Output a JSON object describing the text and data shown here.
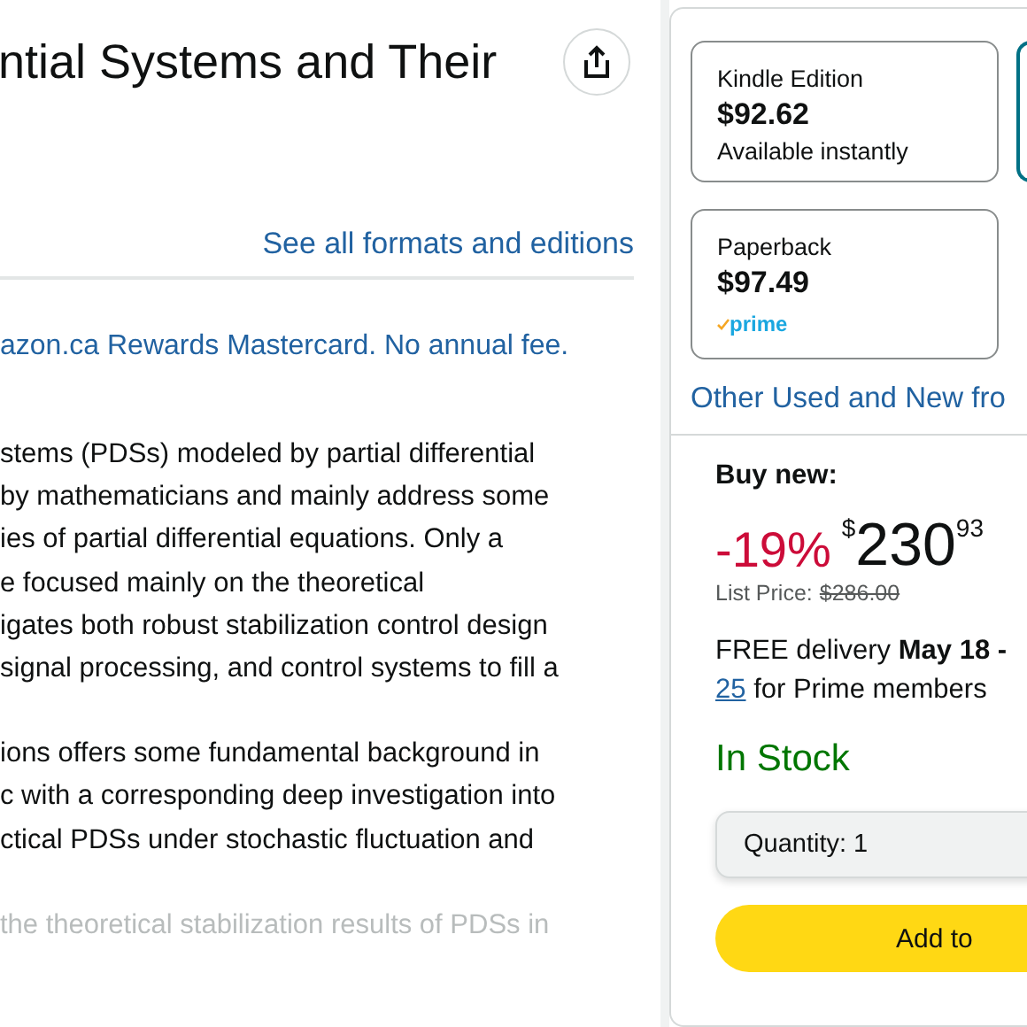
{
  "title": "ntial Systems and Their",
  "formats_link": "See all formats and editions",
  "promo": "azon.ca Rewards Mastercard. No annual fee.",
  "description": [
    [
      "stems (PDSs) modeled by partial differential",
      "by mathematicians and mainly address some",
      "ies of partial differential equations. Only a",
      "e focused mainly on the theoretical",
      "igates both robust stabilization control design",
      "signal processing, and control systems to fill a"
    ],
    [
      "ions offers some fundamental background in",
      "c with a corresponding deep investigation into",
      "ctical PDSs under stochastic fluctuation and"
    ],
    [
      "the theoretical stabilization results of PDSs in"
    ]
  ],
  "formats": [
    {
      "name": "Kindle Edition",
      "price": "$92.62",
      "note": "Available instantly",
      "selected": false
    },
    {
      "name": "Paperback",
      "price": "$97.49",
      "prime_label": "prime",
      "selected": false
    }
  ],
  "other_sellers": "Other Used and New fro",
  "buy": {
    "heading": "Buy new:",
    "discount": "-19%",
    "currency": "$",
    "whole": "230",
    "fraction": "93",
    "list_label": "List Price:",
    "list_price": "$286.00",
    "delivery_prefix": "FREE delivery",
    "delivery_date": "May 18 -",
    "delivery_link": "25",
    "delivery_suffix": "for Prime members",
    "stock": "In Stock",
    "quantity_label": "Quantity:",
    "quantity": "1",
    "cart_button": "Add to"
  }
}
